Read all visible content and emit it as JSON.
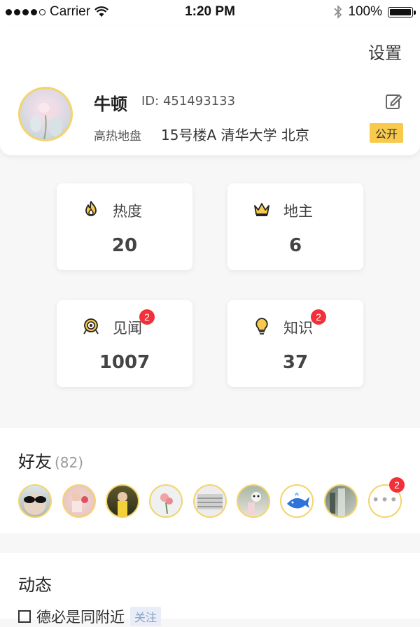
{
  "status_bar": {
    "carrier": "Carrier",
    "time": "1:20 PM",
    "battery": "100%"
  },
  "header": {
    "settings_label": "设置"
  },
  "profile": {
    "name": "牛顿",
    "id_text": "ID: 451493133",
    "location_label": "高热地盘",
    "location_value": "15号楼A  清华大学  北京",
    "visibility": "公开"
  },
  "stats": [
    {
      "label": "热度",
      "value": "20",
      "icon": "flame-icon",
      "badge": ""
    },
    {
      "label": "地主",
      "value": "6",
      "icon": "crown-icon",
      "badge": ""
    },
    {
      "label": "见闻",
      "value": "1007",
      "icon": "target-icon",
      "badge": "2"
    },
    {
      "label": "知识",
      "value": "37",
      "icon": "lightbulb-icon",
      "badge": "2"
    }
  ],
  "friends": {
    "title": "好友",
    "count": "(82)",
    "more_badge": "2"
  },
  "dynamic": {
    "title": "动态",
    "first_item_text": "德必是同附近",
    "first_item_tag": "关注"
  },
  "colors": {
    "accent": "#f8c94a",
    "avatar_border": "#f4d46c",
    "badge_red": "#f2303a"
  }
}
